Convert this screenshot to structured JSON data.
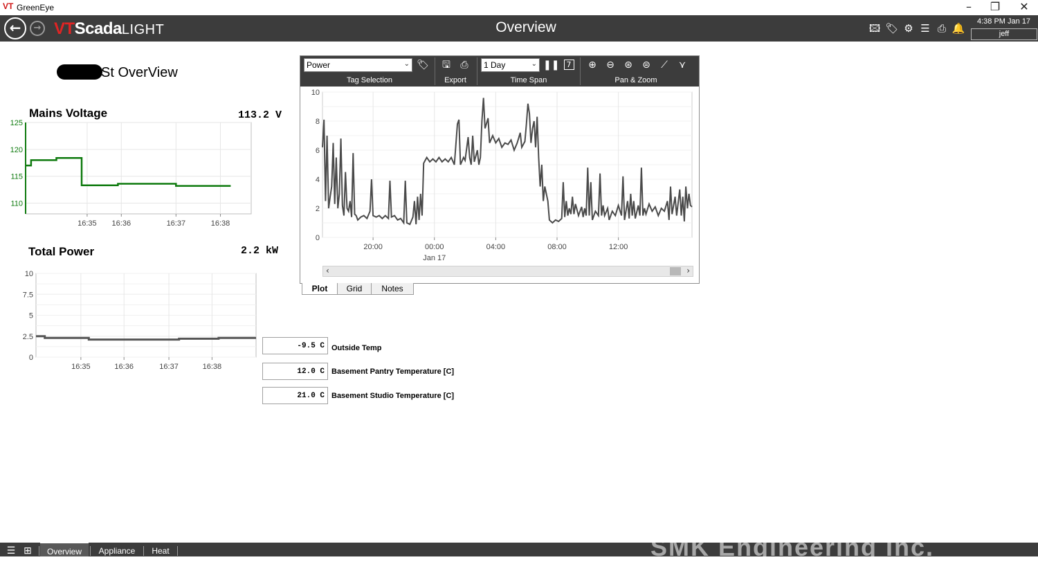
{
  "window": {
    "logo": "VT",
    "title": "GreenEye",
    "minimize": "–",
    "restore": "❐",
    "close": "✕"
  },
  "header": {
    "brand_vt": "VT",
    "brand_scada": "Scada",
    "brand_light": "LIGHT",
    "page_title": "Overview",
    "clock": "4:38 PM  Jan 17",
    "user": "jeff"
  },
  "site": {
    "title": "St OverView"
  },
  "mains_voltage": {
    "title": "Mains Voltage",
    "value": "113.2  V",
    "chart_data": {
      "type": "line",
      "color": "#0e7a0e",
      "ylim": [
        108,
        125
      ],
      "yticks": [
        "125",
        "120",
        "115",
        "110"
      ],
      "xticks": [
        "16:35",
        "16:36",
        "16:37",
        "16:38"
      ],
      "points": [
        [
          0,
          117
        ],
        [
          0.08,
          117
        ],
        [
          0.08,
          118
        ],
        [
          0.45,
          118
        ],
        [
          0.45,
          118.4
        ],
        [
          0.82,
          118.4
        ],
        [
          0.82,
          113.3
        ],
        [
          1.35,
          113.3
        ],
        [
          1.35,
          113.6
        ],
        [
          2.2,
          113.6
        ],
        [
          2.2,
          113.2
        ],
        [
          3.0,
          113.2
        ]
      ]
    }
  },
  "total_power": {
    "title": "Total Power",
    "value": "2.2  kW",
    "chart_data": {
      "type": "line",
      "color": "#555555",
      "ylim": [
        0,
        10
      ],
      "yticks": [
        "10",
        "7.5",
        "5",
        "2.5",
        "0"
      ],
      "xticks": [
        "16:35",
        "16:36",
        "16:37",
        "16:38"
      ],
      "points": [
        [
          0,
          2.5
        ],
        [
          0.2,
          2.5
        ],
        [
          0.2,
          2.3
        ],
        [
          1.2,
          2.3
        ],
        [
          1.2,
          2.1
        ],
        [
          3.25,
          2.1
        ],
        [
          3.25,
          2.2
        ],
        [
          4.15,
          2.2
        ],
        [
          4.15,
          2.3
        ],
        [
          5.0,
          2.3
        ]
      ]
    }
  },
  "trend": {
    "tag_selection": "Power",
    "time_span": "1 Day",
    "group_tag": "Tag Selection",
    "group_export": "Export",
    "group_timespan": "Time Span",
    "group_panzoom": "Pan & Zoom",
    "icons": {
      "tag": "tag-icon",
      "save": "save-icon",
      "print": "print-icon",
      "pause": "pause-icon",
      "calendar": "calendar-icon",
      "zoom_in": "zoom-in-icon",
      "zoom_out": "zoom-out-icon",
      "zoom_x": "zoom-x-icon",
      "zoom_y": "zoom-y-icon",
      "fit": "fit-icon",
      "filter": "filter-icon"
    },
    "calendar_day": "7",
    "tabs": [
      "Plot",
      "Grid",
      "Notes"
    ],
    "chart_data": {
      "type": "line",
      "color": "#4a4a4a",
      "ylim": [
        0,
        10
      ],
      "yticks": [
        "10",
        "8",
        "6",
        "4",
        "2",
        "0"
      ],
      "xticks": [
        "20:00",
        "00:00",
        "04:00",
        "08:00",
        "12:00"
      ],
      "x_sublabel": "Jan 17",
      "x_start_hour": 16.7,
      "x_end_hour": 40.8,
      "points": [
        [
          16.7,
          6.2
        ],
        [
          16.8,
          8.1
        ],
        [
          16.9,
          2.5
        ],
        [
          17.0,
          7.0
        ],
        [
          17.1,
          2.0
        ],
        [
          17.2,
          2.8
        ],
        [
          17.3,
          3.5
        ],
        [
          17.4,
          6.5
        ],
        [
          17.5,
          2.3
        ],
        [
          17.6,
          5.5
        ],
        [
          17.7,
          2.0
        ],
        [
          17.8,
          3.0
        ],
        [
          17.9,
          6.8
        ],
        [
          18.0,
          2.2
        ],
        [
          18.1,
          1.5
        ],
        [
          18.2,
          4.5
        ],
        [
          18.3,
          2.0
        ],
        [
          18.4,
          1.8
        ],
        [
          18.5,
          2.5
        ],
        [
          18.6,
          1.4
        ],
        [
          18.7,
          5.8
        ],
        [
          18.8,
          1.6
        ],
        [
          18.9,
          1.5
        ],
        [
          19.0,
          1.2
        ],
        [
          19.2,
          1.4
        ],
        [
          19.4,
          1.5
        ],
        [
          19.6,
          1.3
        ],
        [
          19.8,
          1.8
        ],
        [
          19.9,
          4.0
        ],
        [
          20.0,
          1.5
        ],
        [
          20.2,
          1.4
        ],
        [
          20.4,
          1.5
        ],
        [
          20.6,
          1.3
        ],
        [
          20.8,
          1.5
        ],
        [
          21.0,
          1.3
        ],
        [
          21.1,
          3.9
        ],
        [
          21.2,
          1.4
        ],
        [
          21.4,
          1.5
        ],
        [
          21.6,
          1.2
        ],
        [
          21.8,
          1.3
        ],
        [
          22.0,
          1.0
        ],
        [
          22.1,
          3.9
        ],
        [
          22.2,
          1.0
        ],
        [
          22.4,
          0.9
        ],
        [
          22.6,
          1.4
        ],
        [
          22.7,
          2.5
        ],
        [
          22.8,
          0.9
        ],
        [
          22.9,
          2.8
        ],
        [
          23.0,
          1.2
        ],
        [
          23.1,
          3.0
        ],
        [
          23.2,
          1.5
        ],
        [
          23.3,
          5.1
        ],
        [
          23.5,
          5.5
        ],
        [
          23.7,
          5.2
        ],
        [
          23.9,
          5.4
        ],
        [
          24.1,
          5.2
        ],
        [
          24.3,
          5.5
        ],
        [
          24.5,
          5.2
        ],
        [
          24.7,
          5.4
        ],
        [
          24.9,
          5.2
        ],
        [
          25.1,
          5.5
        ],
        [
          25.3,
          5.0
        ],
        [
          25.5,
          7.8
        ],
        [
          25.6,
          8.1
        ],
        [
          25.7,
          5.0
        ],
        [
          25.9,
          5.5
        ],
        [
          26.0,
          5.3
        ],
        [
          26.2,
          6.9
        ],
        [
          26.3,
          5.5
        ],
        [
          26.4,
          5.0
        ],
        [
          26.5,
          7.0
        ],
        [
          26.6,
          5.2
        ],
        [
          26.8,
          6.0
        ],
        [
          26.9,
          5.0
        ],
        [
          27.0,
          5.5
        ],
        [
          27.1,
          8.0
        ],
        [
          27.2,
          9.6
        ],
        [
          27.3,
          7.5
        ],
        [
          27.5,
          8.2
        ],
        [
          27.6,
          6.5
        ],
        [
          27.8,
          7.0
        ],
        [
          28.0,
          6.5
        ],
        [
          28.2,
          6.8
        ],
        [
          28.4,
          6.2
        ],
        [
          28.6,
          6.5
        ],
        [
          28.8,
          6.4
        ],
        [
          29.0,
          6.7
        ],
        [
          29.2,
          6.0
        ],
        [
          29.4,
          6.5
        ],
        [
          29.6,
          7.2
        ],
        [
          29.7,
          6.2
        ],
        [
          29.9,
          6.6
        ],
        [
          30.0,
          7.8
        ],
        [
          30.1,
          9.2
        ],
        [
          30.2,
          8.5
        ],
        [
          30.3,
          6.5
        ],
        [
          30.4,
          7.5
        ],
        [
          30.5,
          8.0
        ],
        [
          30.6,
          6.2
        ],
        [
          30.7,
          8.3
        ],
        [
          30.8,
          5.5
        ],
        [
          30.9,
          3.5
        ],
        [
          31.0,
          5.0
        ],
        [
          31.1,
          2.5
        ],
        [
          31.2,
          3.5
        ],
        [
          31.3,
          3.0
        ],
        [
          31.4,
          2.5
        ],
        [
          31.5,
          1.2
        ],
        [
          31.7,
          1.0
        ],
        [
          31.9,
          1.2
        ],
        [
          32.1,
          1.1
        ],
        [
          32.3,
          1.3
        ],
        [
          32.4,
          3.8
        ],
        [
          32.5,
          1.4
        ],
        [
          32.6,
          2.5
        ],
        [
          32.7,
          1.5
        ],
        [
          32.8,
          2.0
        ],
        [
          32.9,
          1.6
        ],
        [
          33.0,
          2.8
        ],
        [
          33.1,
          1.6
        ],
        [
          33.2,
          2.3
        ],
        [
          33.4,
          1.5
        ],
        [
          33.6,
          2.1
        ],
        [
          33.7,
          1.4
        ],
        [
          33.8,
          2.0
        ],
        [
          33.9,
          1.5
        ],
        [
          34.0,
          4.8
        ],
        [
          34.1,
          1.5
        ],
        [
          34.2,
          3.8
        ],
        [
          34.3,
          1.2
        ],
        [
          34.5,
          1.8
        ],
        [
          34.7,
          1.5
        ],
        [
          34.8,
          4.4
        ],
        [
          34.9,
          1.5
        ],
        [
          35.0,
          2.2
        ],
        [
          35.1,
          1.5
        ],
        [
          35.3,
          2.0
        ],
        [
          35.4,
          1.2
        ],
        [
          35.6,
          1.8
        ],
        [
          35.8,
          1.5
        ],
        [
          36.0,
          2.2
        ],
        [
          36.2,
          1.5
        ],
        [
          36.3,
          4.2
        ],
        [
          36.4,
          1.2
        ],
        [
          36.6,
          2.5
        ],
        [
          36.7,
          1.3
        ],
        [
          36.8,
          3.0
        ],
        [
          36.9,
          1.5
        ],
        [
          37.0,
          2.5
        ],
        [
          37.1,
          1.3
        ],
        [
          37.3,
          2.2
        ],
        [
          37.4,
          1.5
        ],
        [
          37.5,
          4.8
        ],
        [
          37.6,
          1.5
        ],
        [
          37.7,
          2.0
        ],
        [
          37.8,
          1.6
        ],
        [
          38.0,
          2.3
        ],
        [
          38.2,
          1.8
        ],
        [
          38.4,
          2.1
        ],
        [
          38.6,
          1.5
        ],
        [
          38.8,
          2.0
        ],
        [
          39.0,
          1.8
        ],
        [
          39.2,
          2.5
        ],
        [
          39.3,
          1.2
        ],
        [
          39.4,
          3.5
        ],
        [
          39.5,
          1.6
        ],
        [
          39.7,
          2.8
        ],
        [
          39.8,
          1.5
        ],
        [
          40.0,
          3.3
        ],
        [
          40.1,
          1.5
        ],
        [
          40.2,
          2.8
        ],
        [
          40.3,
          1.1
        ],
        [
          40.4,
          3.5
        ],
        [
          40.5,
          2.0
        ],
        [
          40.6,
          3.0
        ],
        [
          40.7,
          2.2
        ],
        [
          40.8,
          2.1
        ]
      ]
    }
  },
  "temps": [
    {
      "value": "-9.5 C",
      "label": "Outside Temp"
    },
    {
      "value": "12.0 C",
      "label": "Basement Pantry Temperature [C]"
    },
    {
      "value": "21.0 C",
      "label": "Basement Studio Temperature [C]"
    }
  ],
  "bottom": {
    "menu_icon": "menu-icon",
    "grid_icon": "grid-icon",
    "tabs": [
      "Overview",
      "Appliance",
      "Heat"
    ],
    "watermark": "SMK  Engineering  Inc."
  }
}
